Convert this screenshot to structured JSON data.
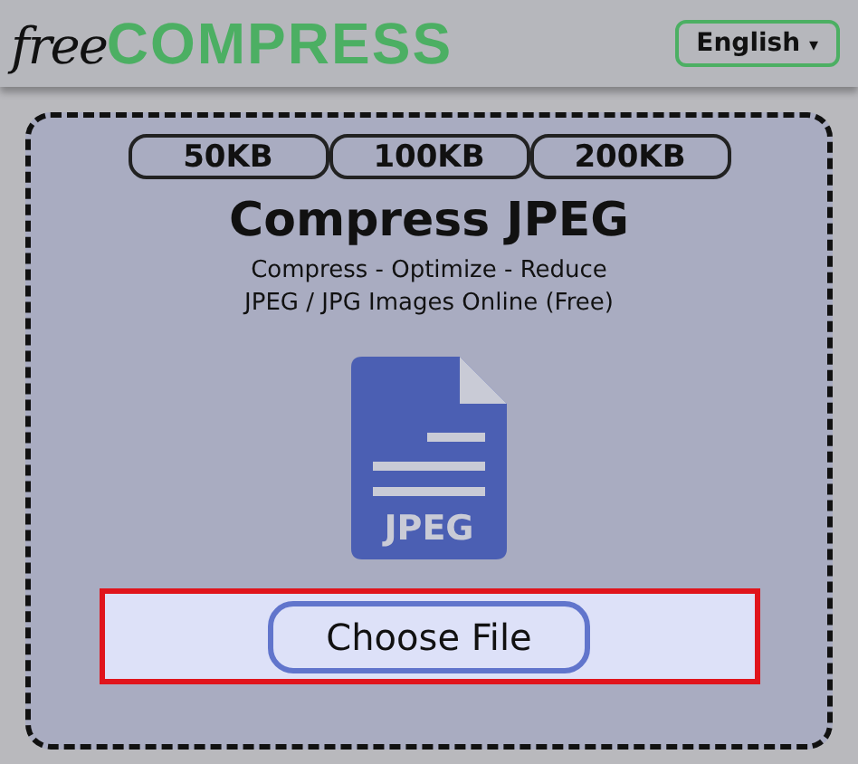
{
  "header": {
    "logo": {
      "script_part": "free",
      "bold_part": "COMPRESS"
    },
    "language": {
      "label": "English",
      "caret": "▾"
    }
  },
  "size_buttons": [
    "50KB",
    "100KB",
    "200KB"
  ],
  "title": "Compress JPEG",
  "subtitle_lines": [
    "Compress - Optimize - Reduce",
    "JPEG / JPG Images Online (Free)"
  ],
  "file_icon": {
    "label": "JPEG"
  },
  "upload": {
    "button": "Choose File"
  }
}
